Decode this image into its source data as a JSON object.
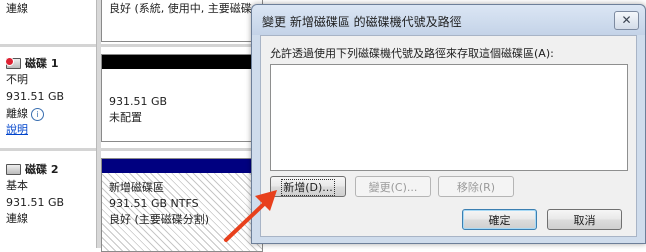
{
  "disks": {
    "top": {
      "status": "連線",
      "partition_line": "良好 (系統, 使用中, 主要磁碟"
    },
    "disk1": {
      "name": "磁碟 1",
      "type": "不明",
      "size": "931.51 GB",
      "status": "離線",
      "help": "說明",
      "partition_size": "931.51 GB",
      "partition_state": "未配置"
    },
    "disk2": {
      "name": "磁碟 2",
      "type": "基本",
      "size": "931.51 GB",
      "status": "連線",
      "partition_name": "新增磁碟區",
      "partition_size": "931.51 GB NTFS",
      "partition_state": "良好 (主要磁碟分割)"
    }
  },
  "dialog": {
    "title": "變更 新增磁碟區 的磁碟機代號及路徑",
    "close_glyph": "✕",
    "instruction": "允許透過使用下列磁碟機代號及路徑來存取這個磁碟區(A):",
    "buttons": {
      "add": "新增(D)...",
      "change": "變更(C)...",
      "remove": "移除(R)",
      "ok": "確定",
      "cancel": "取消"
    }
  },
  "colors": {
    "unallocated_header": "#000000",
    "primary_header": "#000080",
    "annotation_arrow": "#e8401c"
  }
}
